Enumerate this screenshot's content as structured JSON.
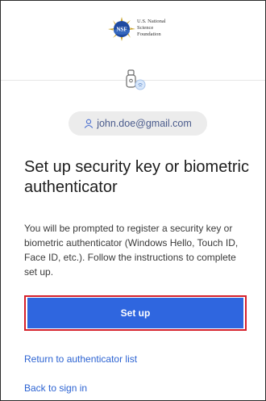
{
  "org": {
    "logo_text": "NSF",
    "name_lines": [
      "U.S. National",
      "Science",
      "Foundation"
    ]
  },
  "user": {
    "email": "john.doe@gmail.com"
  },
  "icons": {
    "key": "security-key-icon",
    "user": "user-icon"
  },
  "main": {
    "title": "Set up security key or biometric authenticator",
    "description": "You will be prompted to register a security key or biometric authenticator (Windows Hello, Touch ID, Face ID, etc.). Follow the instructions to complete set up.",
    "setup_button_label": "Set up"
  },
  "links": {
    "return_label": "Return to authenticator list",
    "back_label": "Back to sign in"
  },
  "colors": {
    "primary_button": "#2f66df",
    "highlight_outline": "#d6202b",
    "link": "#2c63d2"
  }
}
